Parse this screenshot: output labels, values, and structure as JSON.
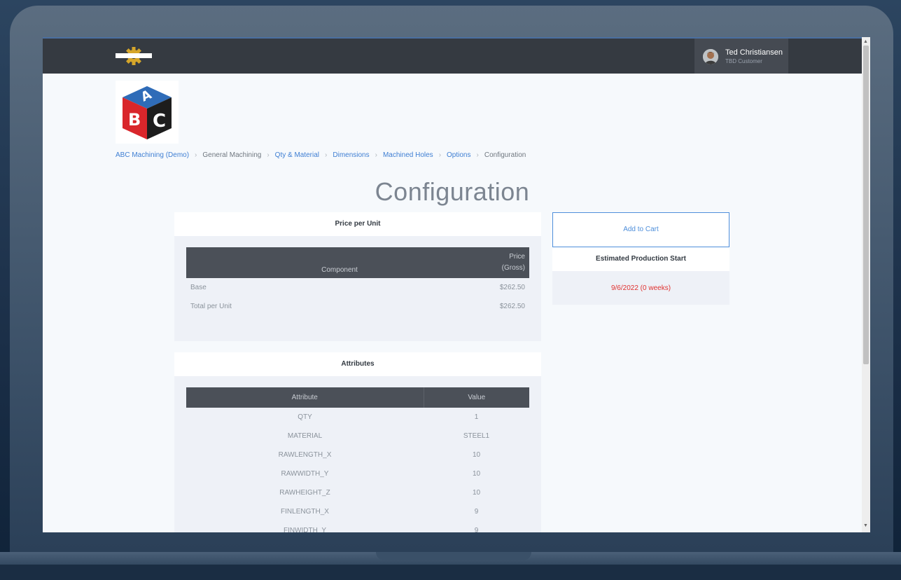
{
  "user": {
    "name": "Ted Christiansen",
    "role": "TBD Customer"
  },
  "breadcrumb": [
    {
      "label": "ABC Machining (Demo)",
      "link": true
    },
    {
      "label": "General Machining",
      "link": false
    },
    {
      "label": "Qty & Material",
      "link": true
    },
    {
      "label": "Dimensions",
      "link": true
    },
    {
      "label": "Machined Holes",
      "link": true
    },
    {
      "label": "Options",
      "link": true
    },
    {
      "label": "Configuration",
      "link": false
    }
  ],
  "page_title": "Configuration",
  "price_card": {
    "title": "Price per Unit",
    "headers": {
      "component": "Component",
      "price_line1": "Price",
      "price_line2": "(Gross)"
    },
    "rows": [
      {
        "label": "Base",
        "value": "$262.50"
      },
      {
        "label": "Total per Unit",
        "value": "$262.50"
      }
    ]
  },
  "attributes_card": {
    "title": "Attributes",
    "headers": {
      "attribute": "Attribute",
      "value": "Value"
    },
    "rows": [
      {
        "attribute": "QTY",
        "value": "1"
      },
      {
        "attribute": "MATERIAL",
        "value": "STEEL1"
      },
      {
        "attribute": "RAWLENGTH_X",
        "value": "10"
      },
      {
        "attribute": "RAWWIDTH_Y",
        "value": "10"
      },
      {
        "attribute": "RAWHEIGHT_Z",
        "value": "10"
      },
      {
        "attribute": "FINLENGTH_X",
        "value": "9"
      },
      {
        "attribute": "FINWIDTH_Y",
        "value": "9"
      }
    ]
  },
  "cart": {
    "add_label": "Add to Cart"
  },
  "production": {
    "title": "Estimated Production Start",
    "date": "9/6/2022 (0 weeks)"
  },
  "colors": {
    "link": "#3f7fd3",
    "accent_gold": "#d6a62a",
    "date_red": "#e0312f",
    "navbar": "#353a41"
  },
  "icons": {
    "nav_logo": "gear-logo-icon",
    "company_logo": "abc-cube-logo",
    "scroll_up": "triangle-up",
    "scroll_down": "triangle-down"
  }
}
